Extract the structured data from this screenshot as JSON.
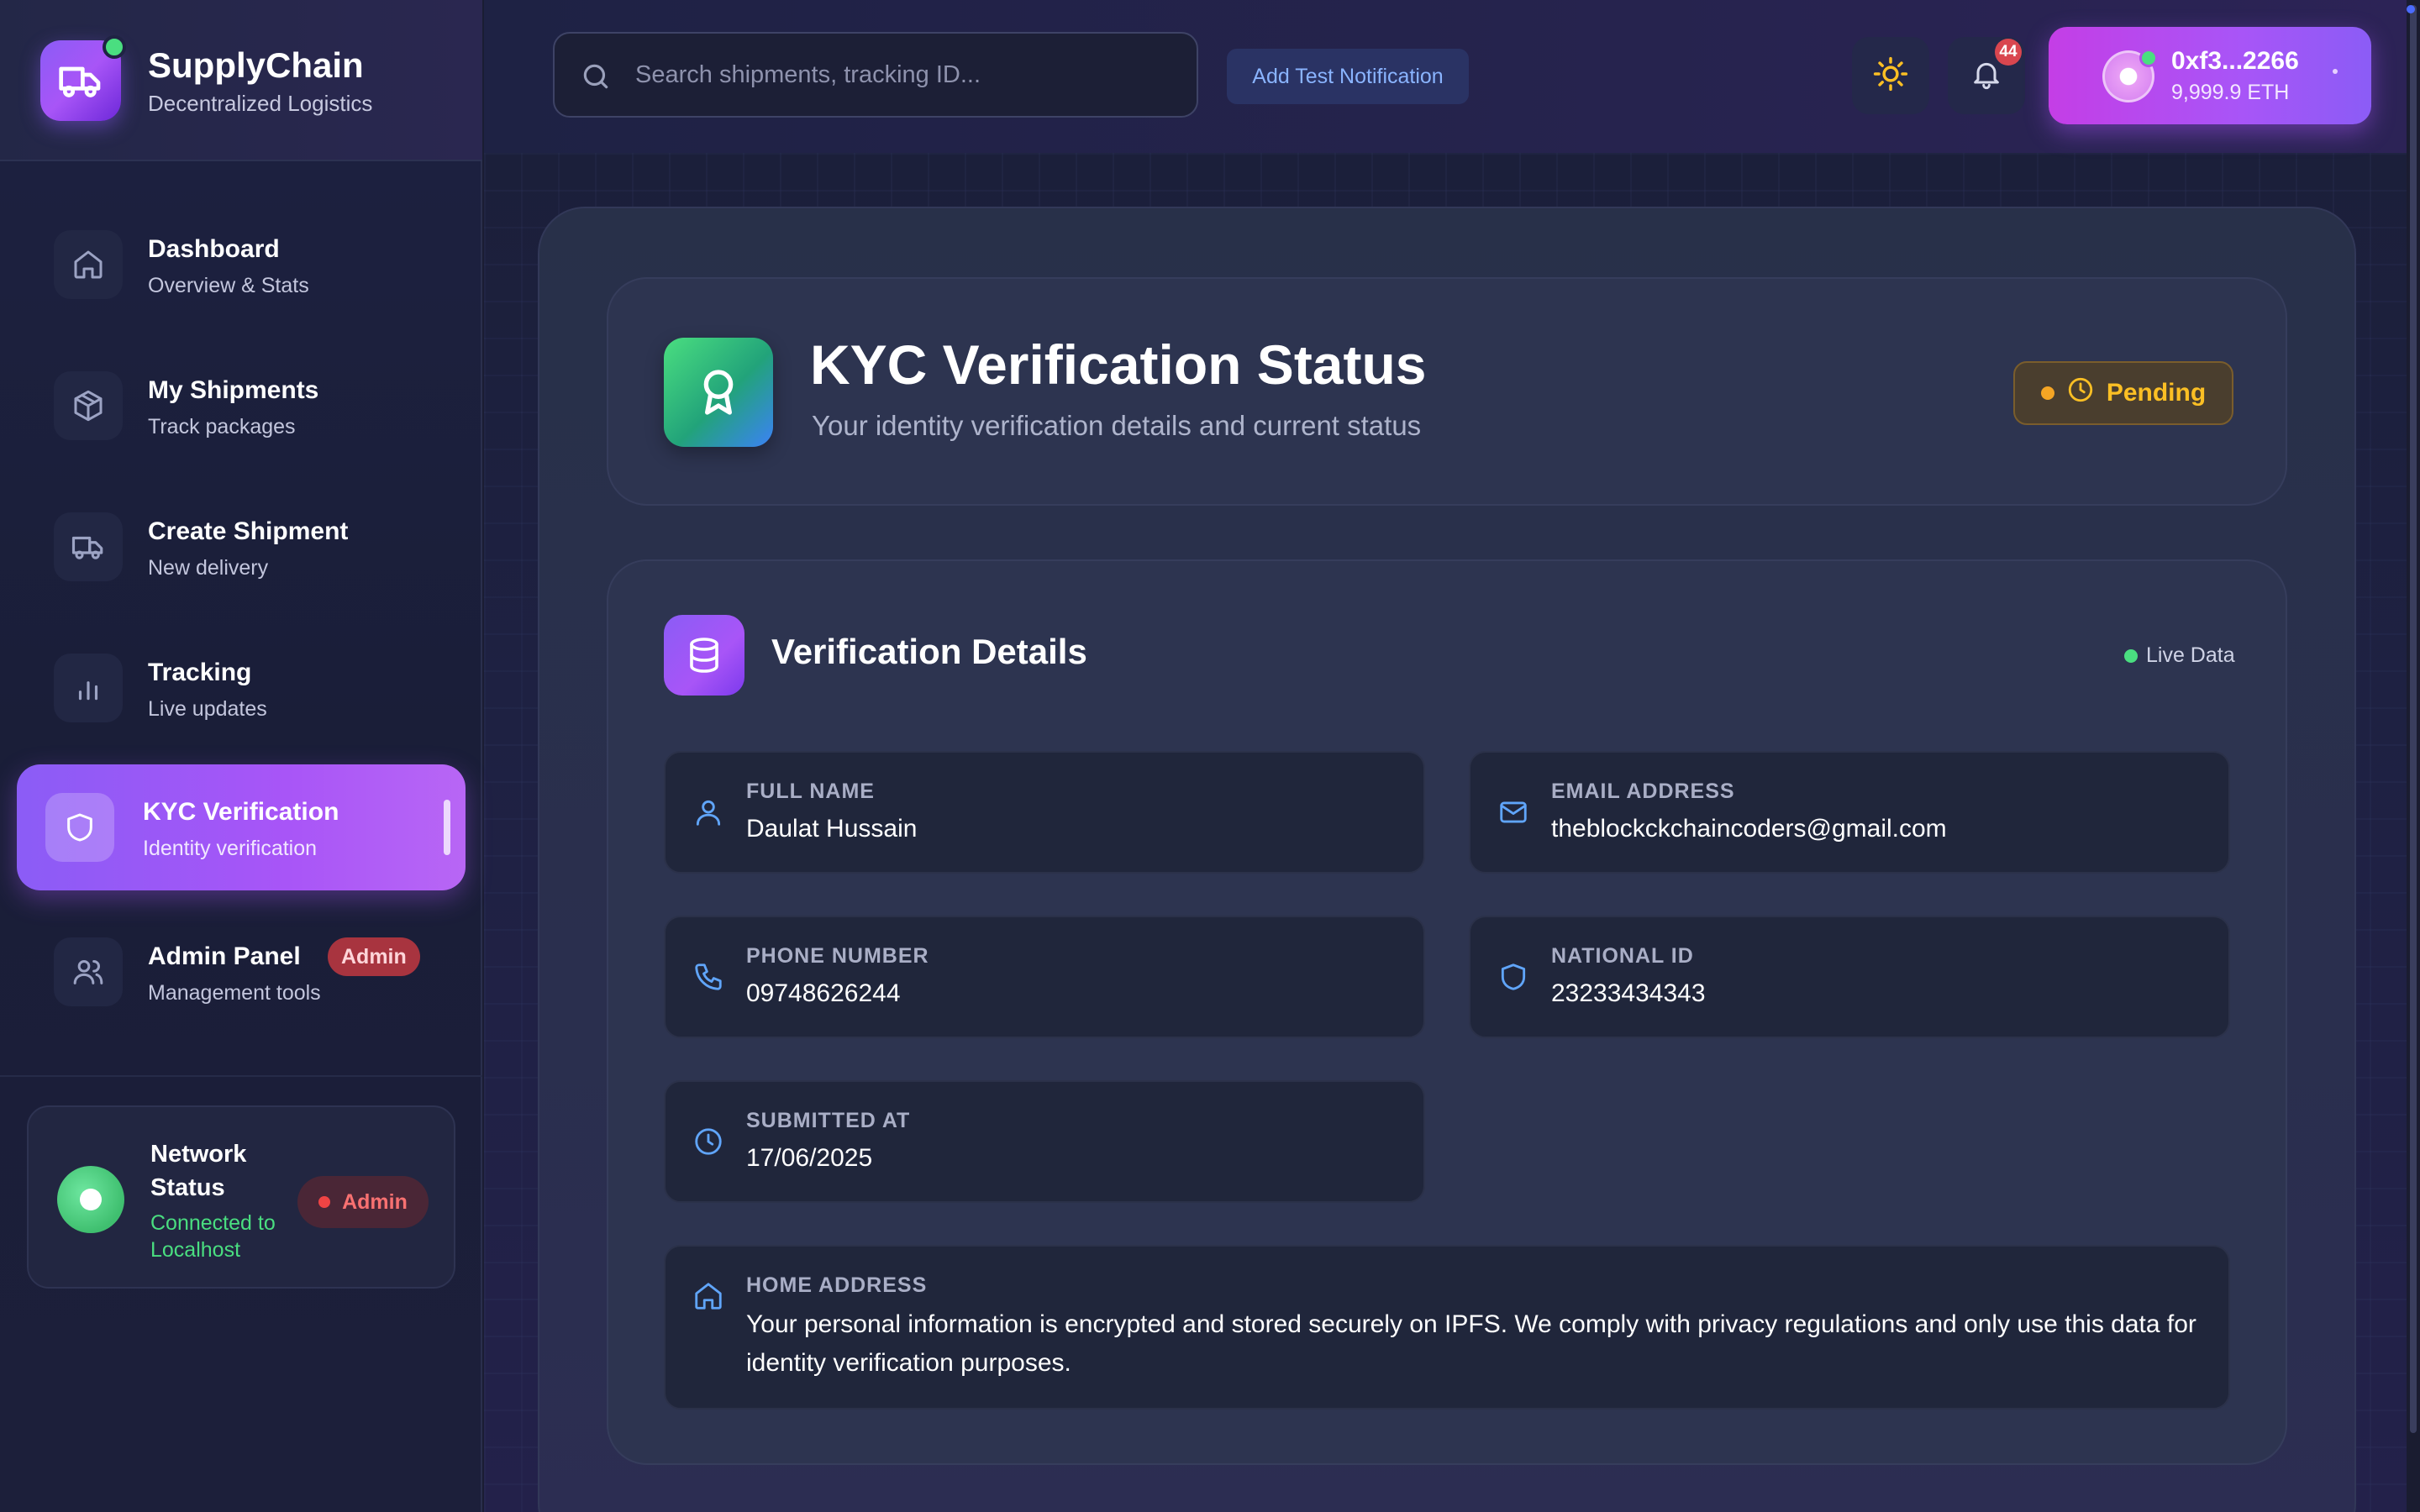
{
  "brand": {
    "title": "SupplyChain",
    "subtitle": "Decentralized Logistics"
  },
  "nav": [
    {
      "title": "Dashboard",
      "subtitle": "Overview & Stats",
      "icon": "home-icon"
    },
    {
      "title": "My Shipments",
      "subtitle": "Track packages",
      "icon": "package-icon"
    },
    {
      "title": "Create Shipment",
      "subtitle": "New delivery",
      "icon": "truck-icon"
    },
    {
      "title": "Tracking",
      "subtitle": "Live updates",
      "icon": "bar-chart-icon"
    },
    {
      "title": "KYC Verification",
      "subtitle": "Identity verification",
      "icon": "shield-icon",
      "active": true
    },
    {
      "title": "Admin Panel",
      "subtitle": "Management tools",
      "icon": "users-icon",
      "badge": "Admin"
    }
  ],
  "network": {
    "title": "Network Status",
    "status": "Connected to Localhost",
    "badge": "Admin"
  },
  "header": {
    "search_placeholder": "Search shipments, tracking ID...",
    "test_button": "Add Test Notification",
    "notification_count": "44",
    "wallet_address": "0xf3...2266",
    "wallet_balance": "9,999.9 ETH"
  },
  "status": {
    "title": "KYC Verification Status",
    "subtitle": "Your identity verification details and current status",
    "state": "Pending"
  },
  "details": {
    "title": "Verification Details",
    "live_label": "Live Data",
    "fields": {
      "full_name": {
        "label": "FULL NAME",
        "value": "Daulat Hussain"
      },
      "email": {
        "label": "EMAIL ADDRESS",
        "value": "theblockckchaincoders@gmail.com"
      },
      "phone": {
        "label": "PHONE NUMBER",
        "value": "09748626244"
      },
      "national_id": {
        "label": "NATIONAL ID",
        "value": "23233434343"
      },
      "submitted_at": {
        "label": "SUBMITTED AT",
        "value": "17/06/2025"
      },
      "home_address": {
        "label": "HOME ADDRESS",
        "value": "Your personal information is encrypted and stored securely on IPFS. We comply with privacy regulations and only use this data for identity verification purposes."
      }
    }
  },
  "colors": {
    "accent": "#a855f7",
    "success": "#4ade80",
    "warning": "#fbbf24",
    "danger": "#ef4444"
  }
}
